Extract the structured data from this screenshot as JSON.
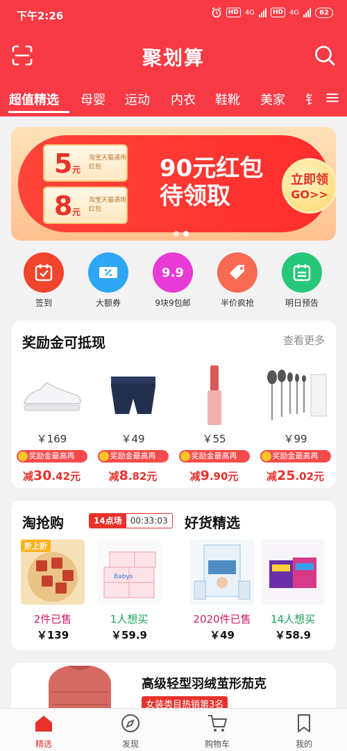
{
  "status_bar": {
    "time": "下午2:26",
    "net1": "4G",
    "net2": "4G",
    "hd": "HD",
    "battery": "62"
  },
  "header": {
    "title": "聚划算"
  },
  "tabs": [
    {
      "label": "超值精选",
      "active": true
    },
    {
      "label": "母婴"
    },
    {
      "label": "运动"
    },
    {
      "label": "内衣"
    },
    {
      "label": "鞋靴"
    },
    {
      "label": "美家"
    },
    {
      "label": "钅"
    }
  ],
  "banner": {
    "coupons": [
      {
        "amount": "5",
        "unit": "元",
        "desc": "淘宝天猫通用红包"
      },
      {
        "amount": "8",
        "unit": "元",
        "desc": "淘宝天猫通用红包"
      }
    ],
    "headline_1": "90元红包",
    "headline_2": "待领取",
    "cta_1": "立即领",
    "cta_2": "GO>>"
  },
  "quick_actions": [
    {
      "label": "签到",
      "color": "#f0452c"
    },
    {
      "label": "大额券",
      "color": "#2fa6f5"
    },
    {
      "label": "9块9包邮",
      "color": "#e83ad4",
      "icon_text": "9.9"
    },
    {
      "label": "半价疯抢",
      "color": "#f96a55"
    },
    {
      "label": "明日预告",
      "color": "#26c77a"
    }
  ],
  "reward_section": {
    "title": "奖励金可抵现",
    "more": "查看更多",
    "tag_label": "奖励金最高再",
    "products": [
      {
        "price": "￥169",
        "discount_prefix": "减",
        "discount_main": "30",
        "discount_tail": ".42元"
      },
      {
        "price": "￥49",
        "discount_prefix": "减",
        "discount_main": "8",
        "discount_tail": ".82元"
      },
      {
        "price": "￥55",
        "discount_prefix": "减",
        "discount_main": "9",
        "discount_tail": ".90元"
      },
      {
        "price": "￥99",
        "discount_prefix": "减",
        "discount_main": "25",
        "discount_tail": ".02元"
      }
    ]
  },
  "flash_sale": {
    "title": "淘抢购",
    "session": "14点场",
    "countdown": "00:33:03",
    "badge": "折上折",
    "items": [
      {
        "stat": "2件已售",
        "price": "￥139",
        "stat_color": "#c81e6b"
      },
      {
        "stat": "1人想买",
        "price": "￥59.9",
        "stat_color": "#1a9e5a"
      }
    ]
  },
  "good_picks": {
    "title": "好货精选",
    "items": [
      {
        "stat": "2020件已售",
        "price": "￥49",
        "stat_color": "#c81e6b"
      },
      {
        "stat": "14人想买",
        "price": "￥58.9",
        "stat_color": "#1a9e5a"
      }
    ]
  },
  "feature": {
    "title": "高级轻型羽绒茧形茄克",
    "rank": "女装类目热销第3名"
  },
  "bottom_nav": [
    {
      "label": "精选",
      "active": true
    },
    {
      "label": "发现"
    },
    {
      "label": "购物车"
    },
    {
      "label": "我的"
    }
  ],
  "colors": {
    "brand_red": "#f83a45",
    "price_red": "#e8312b"
  }
}
